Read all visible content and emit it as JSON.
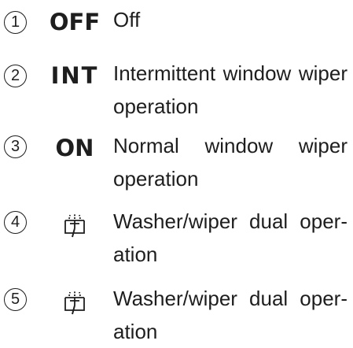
{
  "items": [
    {
      "number": "1",
      "symbol": "OFF",
      "description": "Off"
    },
    {
      "number": "2",
      "symbol": "INT",
      "description": "Intermittent window wiper operation"
    },
    {
      "number": "3",
      "symbol": "ON",
      "description": "Normal window wiper operation"
    },
    {
      "number": "4",
      "symbol_icon": "washer-wiper-icon",
      "description": "Washer/wiper dual oper- ation"
    },
    {
      "number": "5",
      "symbol_icon": "washer-wiper-icon",
      "description": "Washer/wiper dual oper- ation"
    }
  ]
}
